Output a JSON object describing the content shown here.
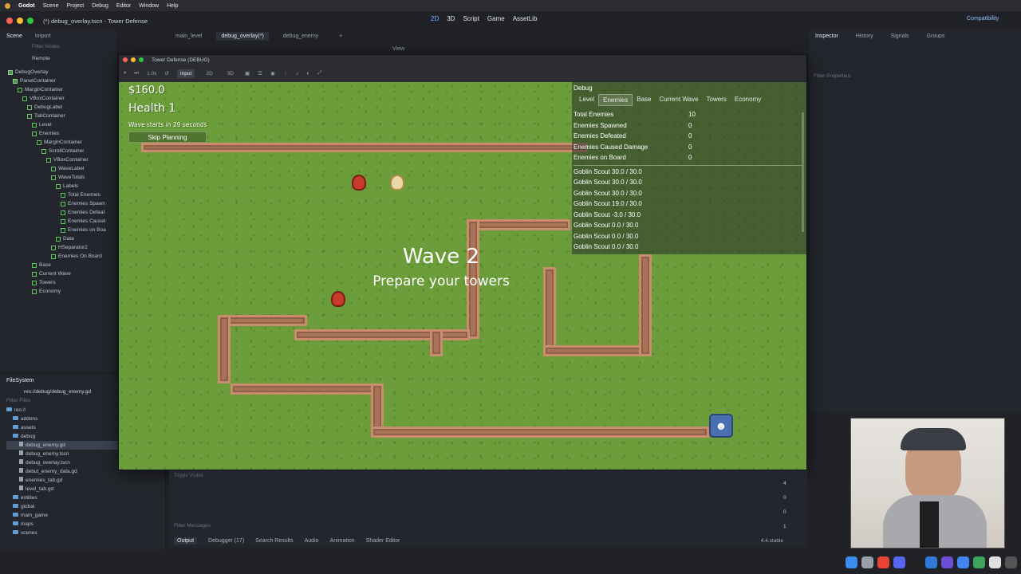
{
  "mac_menu": {
    "app": "Godot",
    "items": [
      "Scene",
      "Project",
      "Debug",
      "Editor",
      "Window",
      "Help"
    ]
  },
  "window_title": "(*) debug_overlay.tscn - Tower Defense",
  "main_tabs": [
    "2D",
    "3D",
    "Script",
    "Game",
    "AssetLib"
  ],
  "renderer": "Compatibility",
  "scene_dock": {
    "tabs": [
      "Scene",
      "Import"
    ],
    "filter_placeholder": "Filter Nodes",
    "remote_label": "Remote",
    "tree": [
      {
        "label": "DebugOverlay",
        "indent": 0
      },
      {
        "label": "PanelContainer",
        "indent": 1
      },
      {
        "label": "MarginContainer",
        "indent": 2
      },
      {
        "label": "VBoxContainer",
        "indent": 3
      },
      {
        "label": "DebugLabel",
        "indent": 4
      },
      {
        "label": "TabContainer",
        "indent": 4
      },
      {
        "label": "Level",
        "indent": 5
      },
      {
        "label": "Enemies",
        "indent": 5
      },
      {
        "label": "MarginContainer",
        "indent": 6
      },
      {
        "label": "ScrollContainer",
        "indent": 7
      },
      {
        "label": "VBoxContainer",
        "indent": 8
      },
      {
        "label": "WaveLabel",
        "indent": 9
      },
      {
        "label": "WaveTotals",
        "indent": 9
      },
      {
        "label": "Labels",
        "indent": 10
      },
      {
        "label": "Total Enemies",
        "indent": 11
      },
      {
        "label": "Enemies Spawn",
        "indent": 11
      },
      {
        "label": "Enemies Defeat",
        "indent": 11
      },
      {
        "label": "Enemies Causel",
        "indent": 11
      },
      {
        "label": "Enemies on Boa",
        "indent": 11
      },
      {
        "label": "Data",
        "indent": 10
      },
      {
        "label": "HSeparator2",
        "indent": 9
      },
      {
        "label": "Enemies On Board",
        "indent": 9
      },
      {
        "label": "Base",
        "indent": 5
      },
      {
        "label": "Current Wave",
        "indent": 5
      },
      {
        "label": "Towers",
        "indent": 5
      },
      {
        "label": "Economy",
        "indent": 5
      }
    ]
  },
  "filesystem": {
    "title": "FileSystem",
    "path": "res://debug/debug_enemy.gd",
    "filter_placeholder": "Filter Files",
    "items": [
      {
        "label": "res://",
        "type": "folder",
        "indent": 0
      },
      {
        "label": "addons",
        "type": "folder",
        "indent": 1
      },
      {
        "label": "assets",
        "type": "folder",
        "indent": 1
      },
      {
        "label": "debug",
        "type": "folder",
        "indent": 1
      },
      {
        "label": "debug_enemy.gd",
        "type": "file",
        "indent": 2,
        "selected": true
      },
      {
        "label": "debug_enemy.tscn",
        "type": "file",
        "indent": 2
      },
      {
        "label": "debug_overlay.tscn",
        "type": "file",
        "indent": 2
      },
      {
        "label": "debut_enemy_data.gd",
        "type": "file",
        "indent": 2
      },
      {
        "label": "enemies_tab.gd",
        "type": "file",
        "indent": 2
      },
      {
        "label": "level_tab.gd",
        "type": "file",
        "indent": 2
      },
      {
        "label": "entities",
        "type": "folder",
        "indent": 1
      },
      {
        "label": "global",
        "type": "folder",
        "indent": 1
      },
      {
        "label": "main_game",
        "type": "folder",
        "indent": 1
      },
      {
        "label": "maps",
        "type": "folder",
        "indent": 1
      },
      {
        "label": "scenes",
        "type": "folder",
        "indent": 1
      }
    ]
  },
  "editor_tabs": [
    "main_level",
    "debug_overlay(*)",
    "debug_enemy"
  ],
  "editor_view_label": "View",
  "game_window": {
    "title": "Tower Defense (DEBUG)",
    "zoom": "1.0x",
    "toolbar": [
      "Input",
      "2D",
      "3D"
    ]
  },
  "hud": {
    "money": "$160.0",
    "health": "Health 1",
    "wave_timer": "Wave starts in 29 seconds",
    "skip_label": "Skip Planning",
    "wave_title": "Wave 2",
    "wave_subtitle": "Prepare your towers"
  },
  "debug_panel": {
    "title": "Debug",
    "tabs": [
      "Level",
      "Enemies",
      "Base",
      "Current Wave",
      "Towers",
      "Economy"
    ],
    "active_tab": "Enemies",
    "stats": [
      {
        "k": "Total Enemies",
        "v": "10"
      },
      {
        "k": "Enemies Spawned",
        "v": "0"
      },
      {
        "k": "Enemies Defeated",
        "v": "0"
      },
      {
        "k": "Enemies Caused Damage",
        "v": "0"
      },
      {
        "k": "Enemies on Board",
        "v": "0"
      }
    ],
    "enemies": [
      "Goblin Scout 30.0 / 30.0",
      "Goblin Scout 30.0 / 30.0",
      "Goblin Scout 30.0 / 30.0",
      "Goblin Scout 19.0 / 30.0",
      "Goblin Scout -3.0 / 30.0",
      "Goblin Scout 0.0 / 30.0",
      "Goblin Scout 0.0 / 30.0",
      "Goblin Scout 0.0 / 30.0"
    ]
  },
  "inspector": {
    "tabs": [
      "Inspector",
      "History",
      "Signals",
      "Groups"
    ],
    "filter_placeholder": "Filter Properties"
  },
  "bottom_panel": {
    "tabs": [
      "Output",
      "Debugger (17)",
      "Search Results",
      "Audio",
      "Animation",
      "Shader Editor"
    ],
    "filter_placeholder": "Filter Messages",
    "toggle_label": "Toggle Visible",
    "version": "4.4.stable",
    "counts": [
      "4",
      "0",
      "0",
      "1"
    ]
  },
  "colors": {
    "accent": "#6fb0ff",
    "grass": "#6b9e3a",
    "path": "#a9735a"
  }
}
